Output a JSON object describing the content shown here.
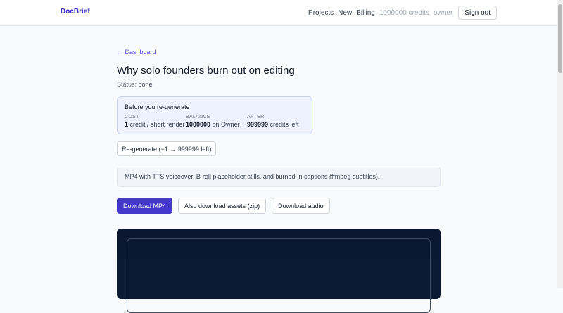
{
  "app": {
    "brand": "DocBrief"
  },
  "nav": {
    "projects": "Projects",
    "new": "New",
    "billing": "Billing",
    "credits": "1000000 credits",
    "role": "owner",
    "sign_out": "Sign out"
  },
  "page": {
    "back_link": "← Dashboard",
    "title": "Why solo founders burn out on editing",
    "status_label": "Status:",
    "status_value": "done"
  },
  "regen_card": {
    "title": "Before you re-generate",
    "cost": {
      "header": "COST",
      "value_bold": "1",
      "value_rest": " credit / short render"
    },
    "balance": {
      "header": "BALANCE",
      "value_bold": "1000000",
      "value_rest": " on Owner"
    },
    "after": {
      "header": "AFTER",
      "value_bold": "999999",
      "value_rest": " credits left"
    }
  },
  "regen_button": "Re-generate (−1 → 999999 left)",
  "info_text": "MP4 with TTS voiceover, B-roll placeholder stills, and burned-in captions (ffmpeg subtitles).",
  "actions": {
    "download_mp4": "Download MP4",
    "download_assets": "Also download assets (zip)",
    "download_audio": "Download audio"
  },
  "colors": {
    "accent": "#4338ca",
    "brand": "#3b2fc9",
    "video_bg": "#0b1730"
  }
}
